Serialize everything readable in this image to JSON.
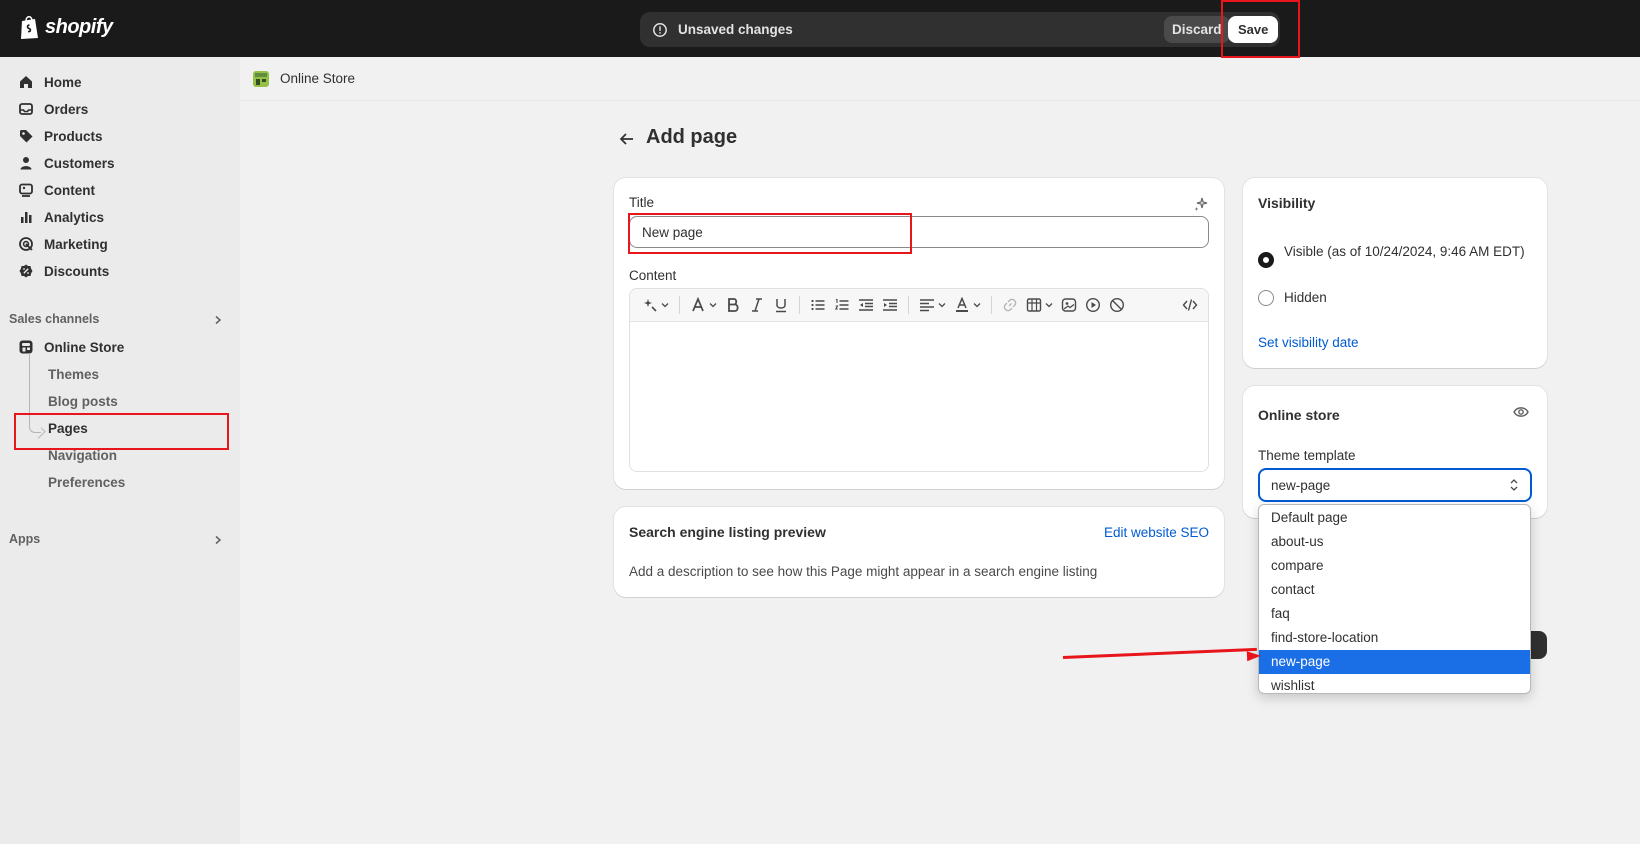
{
  "topbar": {
    "logo_text": "shopify",
    "unsaved_text": "Unsaved changes",
    "discard_label": "Discard",
    "save_label": "Save"
  },
  "sidebar": {
    "items": [
      {
        "label": "Home",
        "icon": "home-icon"
      },
      {
        "label": "Orders",
        "icon": "orders-icon"
      },
      {
        "label": "Products",
        "icon": "tag-icon"
      },
      {
        "label": "Customers",
        "icon": "person-icon"
      },
      {
        "label": "Content",
        "icon": "content-icon"
      },
      {
        "label": "Analytics",
        "icon": "bar-chart-icon"
      },
      {
        "label": "Marketing",
        "icon": "target-icon"
      },
      {
        "label": "Discounts",
        "icon": "discount-icon"
      }
    ],
    "sales_channels_label": "Sales channels",
    "online_store_label": "Online Store",
    "sub_items": [
      "Themes",
      "Blog posts",
      "Pages",
      "Navigation",
      "Preferences"
    ],
    "apps_label": "Apps"
  },
  "breadcrumb": {
    "label": "Online Store"
  },
  "page": {
    "title": "Add page"
  },
  "title_card": {
    "title_label": "Title",
    "title_value": "New page",
    "content_label": "Content"
  },
  "seo": {
    "title": "Search engine listing preview",
    "link": "Edit website SEO",
    "description": "Add a description to see how this Page might appear in a search engine listing"
  },
  "visibility": {
    "title": "Visibility",
    "visible_label": "Visible (as of 10/24/2024, 9:46 AM EDT)",
    "hidden_label": "Hidden",
    "set_date_link": "Set visibility date",
    "selected": "visible"
  },
  "online_store": {
    "title": "Online store",
    "theme_template_label": "Theme template",
    "selected_value": "new-page",
    "options": [
      "Default page",
      "about-us",
      "compare",
      "contact",
      "faq",
      "find-store-location",
      "new-page",
      "wishlist"
    ]
  },
  "colors": {
    "topbar": "#1a1a1a",
    "link": "#005bd3",
    "selection": "#1a6ee6",
    "annotation": "#e8161b"
  }
}
